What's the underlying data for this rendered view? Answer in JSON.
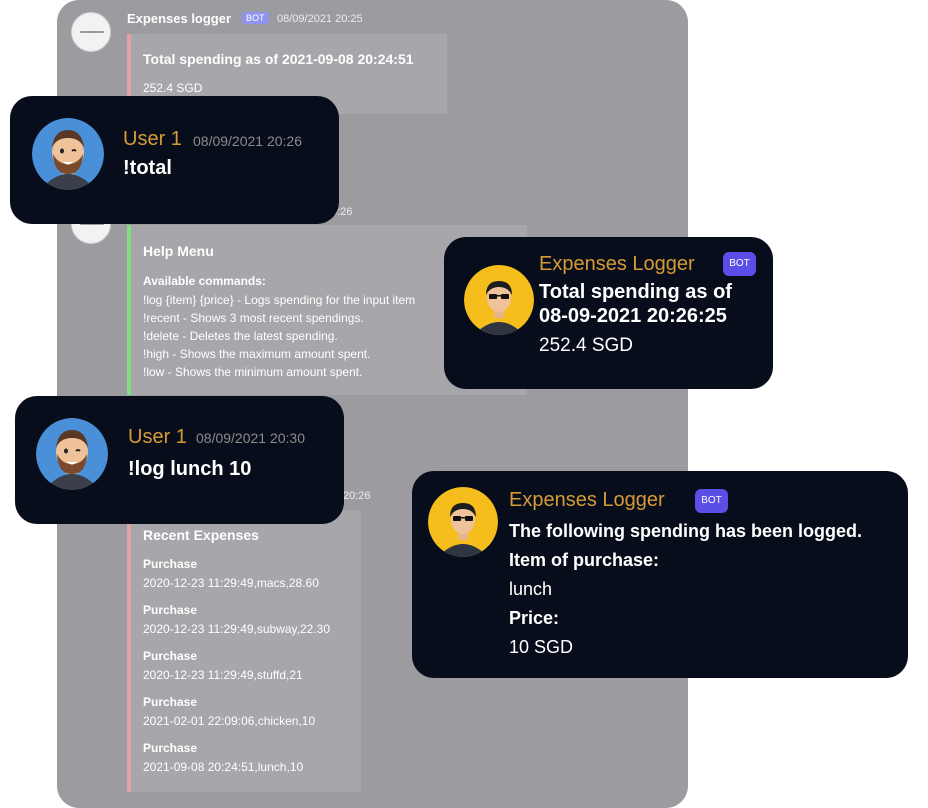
{
  "background": {
    "msg1": {
      "author": "Expenses logger",
      "bot_tag": "BOT",
      "time": "08/09/2021 20:25",
      "embed_title": "Total spending as of 2021-09-08 20:24:51",
      "embed_value": "252.4 SGD"
    },
    "msg2": {
      "time_partial": "20:26",
      "embed_title": "Help Menu",
      "subtitle": "Available commands:",
      "commands": [
        "!log {item} {price} - Logs spending for the input item",
        "!recent - Shows 3 most recent spendings.",
        "!delete - Deletes the latest spending.",
        "!high - Shows the maximum amount spent.",
        "!low - Shows the minimum amount spent."
      ]
    },
    "msg3": {
      "time_partial": "20:26",
      "embed_title": "Recent Expenses",
      "purchases": [
        {
          "label": "Purchase",
          "value": "2020-12-23 11:29:49,macs,28.60"
        },
        {
          "label": "Purchase",
          "value": "2020-12-23 11:29:49,subway,22.30"
        },
        {
          "label": "Purchase",
          "value": "2020-12-23 11:29:49,stuffd,21"
        },
        {
          "label": "Purchase",
          "value": "2021-02-01 22:09:06,chicken,10"
        },
        {
          "label": "Purchase",
          "value": "2021-09-08 20:24:51,lunch,10"
        }
      ]
    }
  },
  "bubbles": {
    "user_total": {
      "name": "User 1",
      "time": "08/09/2021 20:26",
      "text": "!total"
    },
    "bot_total": {
      "name": "Expenses Logger",
      "bot_tag": "BOT",
      "line1": "Total spending as of",
      "line2": "08-09-2021 20:26:25",
      "line3": "252.4 SGD"
    },
    "user_log": {
      "name": "User 1",
      "time": "08/09/2021 20:30",
      "text": "!log lunch 10"
    },
    "bot_log": {
      "name": "Expenses Logger",
      "bot_tag": "BOT",
      "line1": "The following spending has been logged.",
      "line2": "Item of purchase:",
      "line3": "lunch",
      "line4": "Price:",
      "line5": "10 SGD"
    }
  },
  "colors": {
    "bubble_bg": "#070d1a",
    "name_gold": "#d79b36",
    "bot_badge": "#5a4ee6",
    "panel_bg": "#9b9ba0"
  }
}
